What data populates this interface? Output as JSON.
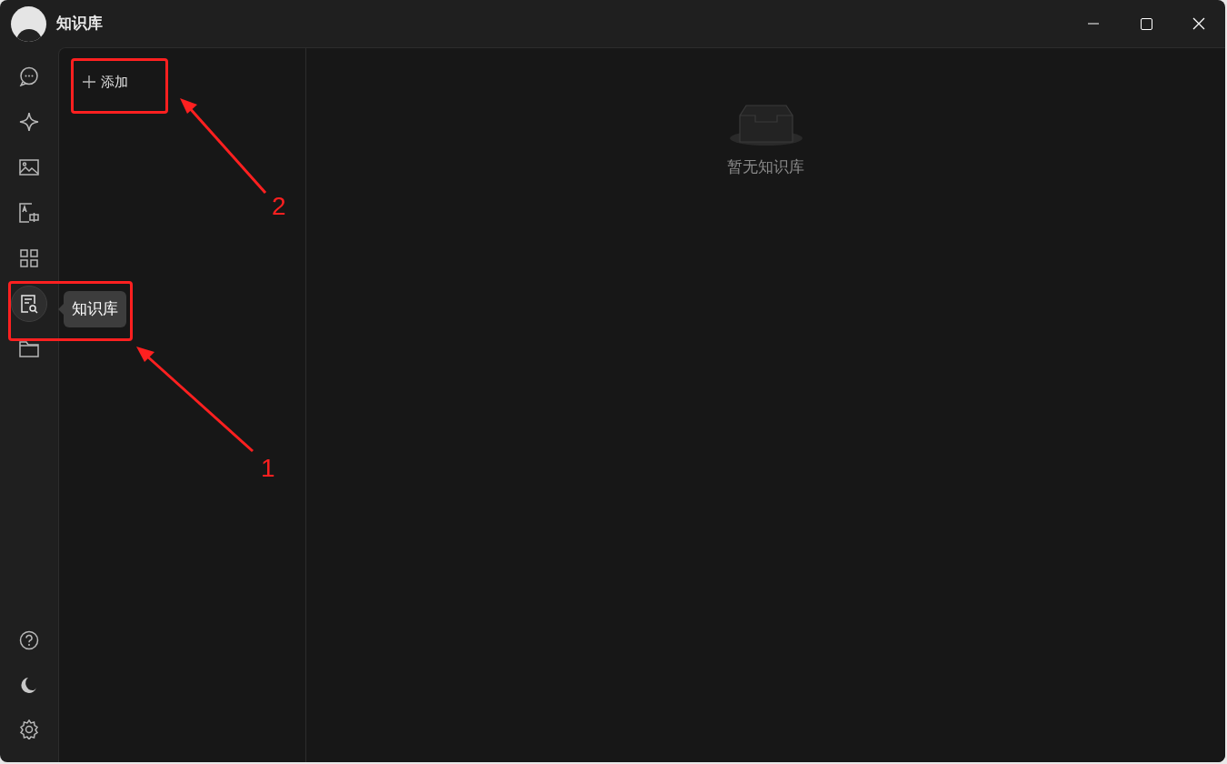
{
  "window": {
    "title": "知识库"
  },
  "nav": {
    "top_items": [
      {
        "selected": false
      },
      {
        "selected": false
      },
      {
        "selected": false
      },
      {
        "selected": false
      },
      {
        "selected": false
      },
      {
        "selected": true
      },
      {
        "selected": false
      }
    ],
    "bottom_items": [
      {
        "selected": false
      },
      {
        "selected": false
      },
      {
        "selected": false
      }
    ],
    "tooltip": "知识库"
  },
  "list_panel": {
    "add_button": "添加"
  },
  "main": {
    "empty_text": "暂无知识库"
  },
  "annotations": [
    {
      "label": "1"
    },
    {
      "label": "2"
    }
  ]
}
